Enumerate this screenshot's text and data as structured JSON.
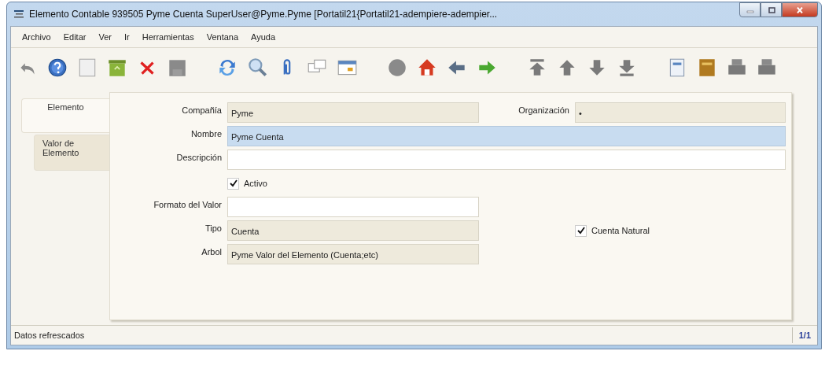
{
  "window": {
    "title": "Elemento Contable  939505  Pyme Cuenta  SuperUser@Pyme.Pyme [Portatil21{Portatil21-adempiere-adempier..."
  },
  "menu": [
    "Archivo",
    "Editar",
    "Ver",
    "Ir",
    "Herramientas",
    "Ventana",
    "Ayuda"
  ],
  "tabs": [
    {
      "label": "Elemento",
      "selected": true
    },
    {
      "label": "Valor de Elemento",
      "selected": false
    }
  ],
  "form_rows": [
    [
      {
        "kind": "field",
        "label": "Compañía",
        "value": "Pyme",
        "read_only": true,
        "focused": false
      },
      {
        "kind": "field",
        "label": "Organización",
        "value": "•",
        "read_only": true,
        "focused": false
      }
    ],
    [
      {
        "kind": "wide_field",
        "label": "Nombre",
        "value": "Pyme Cuenta",
        "read_only": false,
        "focused": true
      }
    ],
    [
      {
        "kind": "wide_field",
        "label": "Descripción",
        "read_only": false,
        "focused": false
      }
    ],
    [
      {
        "kind": "checkbox",
        "label": "Activo",
        "checked": true
      }
    ],
    [
      {
        "kind": "field",
        "label": "Formato del Valor",
        "read_only": false,
        "focused": false
      }
    ],
    [
      {
        "kind": "field",
        "label": "Tipo",
        "value": "Cuenta",
        "read_only": true,
        "focused": false
      },
      {
        "kind": "checkbox",
        "label": "Cuenta Natural",
        "checked": true
      }
    ],
    [
      {
        "kind": "field",
        "label": "Arbol",
        "value": "Pyme Valor del Elemento (Cuenta;etc)",
        "read_only": true,
        "focused": false
      }
    ]
  ],
  "status_bar": {
    "message": "Datos refrescados",
    "record": "1/1"
  }
}
